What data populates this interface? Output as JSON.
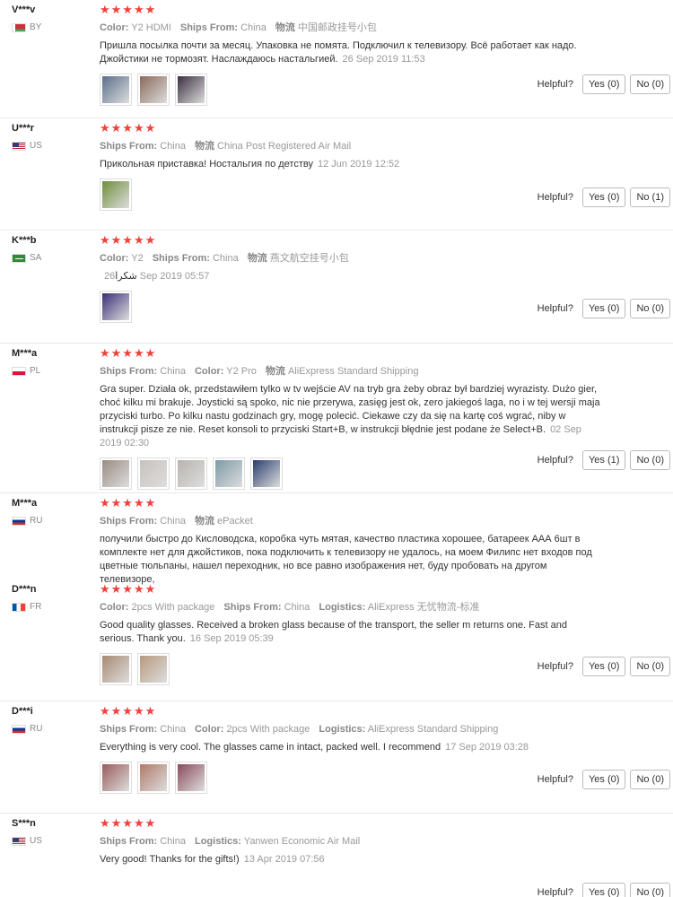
{
  "feedback": {
    "helpful_label": "Helpful?",
    "reviews": [
      {
        "user": "V***v",
        "country": "BY",
        "flag": "flag-by",
        "stars": "★★★★★",
        "meta": [
          [
            "Color:",
            "Y2 HDMI"
          ],
          [
            "Ships From:",
            "China"
          ],
          [
            "物流",
            "中国邮政挂号小包"
          ]
        ],
        "text": "Пришла посылка почти за месяц. Упаковка не помята. Подключил к телевизору. Всё работает как надо. Джойстики не тормозят. Наслаждаюсь настальгией.",
        "date": "26 Sep 2019 11:53",
        "photo_colors": [
          "#5a6f8a",
          "#8a6a5a",
          "#3b2f3f"
        ],
        "yes": "Yes (0)",
        "no": "No (0)"
      },
      {
        "user": "U***r",
        "country": "US",
        "flag": "flag-us",
        "stars": "★★★★★",
        "meta": [
          [
            "Ships From:",
            "China"
          ],
          [
            "物流",
            "China Post Registered Air Mail"
          ]
        ],
        "text": "Прикольная приставка! Ностальгия по детству",
        "date": "12 Jun 2019 12:52",
        "photo_colors": [
          "#6f8f3a"
        ],
        "yes": "Yes (0)",
        "no": "No (1)"
      },
      {
        "user": "K***b",
        "country": "SA",
        "flag": "flag-sa",
        "stars": "★★★★★",
        "meta": [
          [
            "Color:",
            "Y2"
          ],
          [
            "Ships From:",
            "China"
          ],
          [
            "物流",
            "燕文航空挂号小包"
          ]
        ],
        "text": "شكرا",
        "date": "26 Sep 2019 05:57",
        "photo_colors": [
          "#3a2f7a"
        ],
        "yes": "Yes (0)",
        "no": "No (0)"
      },
      {
        "user": "M***a",
        "country": "PL",
        "flag": "flag-pl",
        "stars": "★★★★★",
        "meta": [
          [
            "Ships From:",
            "China"
          ],
          [
            "Color:",
            "Y2 Pro"
          ],
          [
            "物流",
            "AliExpress Standard Shipping"
          ]
        ],
        "text": "Gra super. Działa ok, przedstawiłem tylko w tv wejście AV na tryb gra żeby obraz był bardziej wyrazisty. Dużo gier, choć kilku mi brakuje. Joysticki są spoko, nic nie przerywa, zasięg jest ok, zero jakiegoś laga, no i w tej wersji maja przyciski turbo. Po kilku nastu godzinach gry, mogę polecić. Ciekawe czy da się na kartę coś wgrać, niby w instrukcji pisze ze nie. Reset konsoli to przyciski Start+B, w instrukcji błędnie jest podane że Select+B.",
        "date": "02 Sep 2019 02:30",
        "photo_colors": [
          "#9a8c82",
          "#c8c2bc",
          "#b8b4ae",
          "#7e9aa6",
          "#2a3f6e"
        ],
        "yes": "Yes (1)",
        "no": "No (0)"
      },
      {
        "user": "M***a",
        "country": "RU",
        "flag": "flag-ru",
        "stars": "★★★★★",
        "meta": [
          [
            "Ships From:",
            "China"
          ],
          [
            "物流",
            "ePacket"
          ]
        ],
        "text": "получили быстро до Кисловодска, коробка чуть мятая, качество пластика хорошее, батареек ААА 6шт в комплекте нет для джойстиков, пока подключить к телевизору не удалось, на моем Филипс нет входов под цветные тюльпаны, нашел переходник, но все равно изображения нет, буду пробовать на другом телевизоре,",
        "date": "",
        "photo_colors": [],
        "yes": "",
        "no": ""
      },
      {
        "user": "D***n",
        "country": "FR",
        "flag": "flag-fr",
        "stars": "★★★★★",
        "meta": [
          [
            "Color:",
            "2pcs With package"
          ],
          [
            "Ships From:",
            "China"
          ],
          [
            "Logistics:",
            "AliExpress 无忧物流-标准"
          ]
        ],
        "text": "Good quality glasses. Received a broken glass because of the transport, the seller m returns one. Fast and serious. Thank you.",
        "date": "16 Sep 2019 05:39",
        "photo_colors": [
          "#a88a72",
          "#b89a7e"
        ],
        "yes": "Yes (0)",
        "no": "No (0)"
      },
      {
        "user": "D***i",
        "country": "RU",
        "flag": "flag-ru",
        "stars": "★★★★★",
        "meta": [
          [
            "Ships From:",
            "China"
          ],
          [
            "Color:",
            "2pcs With package"
          ],
          [
            "Logistics:",
            "AliExpress Standard Shipping"
          ]
        ],
        "text": "Everything is very cool. The glasses came in intact, packed well. I recommend",
        "date": "17 Sep 2019 03:28",
        "photo_colors": [
          "#9a5a5a",
          "#b07a6a",
          "#8a4a5a"
        ],
        "yes": "Yes (0)",
        "no": "No (0)"
      },
      {
        "user": "S***n",
        "country": "US",
        "flag": "flag-us",
        "stars": "★★★★★",
        "meta": [
          [
            "Ships From:",
            "China"
          ],
          [
            "Logistics:",
            "Yanwen Economic Air Mail"
          ]
        ],
        "text": "Very good! Thanks for the gifts!)",
        "date": "13 Apr 2019 07:56",
        "photo_colors": [],
        "yes": "Yes (0)",
        "no": "No (0)"
      }
    ]
  }
}
